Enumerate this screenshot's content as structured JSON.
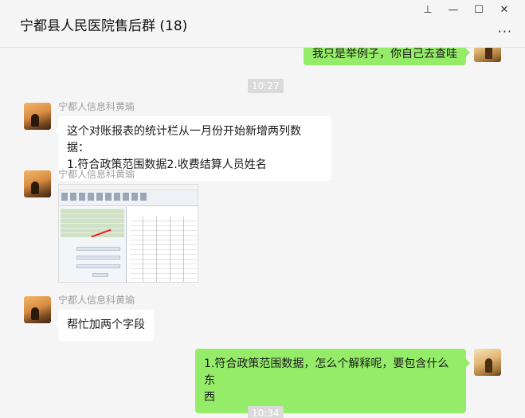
{
  "window": {
    "title": "宁都县人民医院售后群 (18)",
    "controls": {
      "pin": "⊥",
      "minimize": "—",
      "maximize": "☐",
      "close": "✕"
    },
    "more": "···"
  },
  "messages": [
    {
      "type": "outgoing-text",
      "text": "我只是举例子，你自己去查哇"
    },
    {
      "type": "time",
      "text": "10:27"
    },
    {
      "type": "incoming-text",
      "sender": "宁都人信息科黄瑜",
      "lines": [
        "这个对账报表的统计栏从一月份开始新增两列数据：",
        "1.符合政策范围数据2.收费结算人员姓名"
      ]
    },
    {
      "type": "incoming-image",
      "sender": "宁都人信息科黄瑜"
    },
    {
      "type": "incoming-text",
      "sender": "宁都人信息科黄瑜",
      "lines": [
        "帮忙加两个字段"
      ]
    },
    {
      "type": "outgoing-text",
      "lines": [
        "1.符合政策范围数据，怎么个解释呢，要包含什么东",
        "西"
      ]
    },
    {
      "type": "time",
      "text": "10:34"
    }
  ],
  "icons": {
    "pin": "pin-icon",
    "minimize": "minimize-icon",
    "maximize": "maximize-icon",
    "close": "close-icon",
    "more": "more-icon"
  },
  "colors": {
    "own_bubble": "#95ec69",
    "other_bubble": "#ffffff",
    "background": "#f5f5f5"
  }
}
